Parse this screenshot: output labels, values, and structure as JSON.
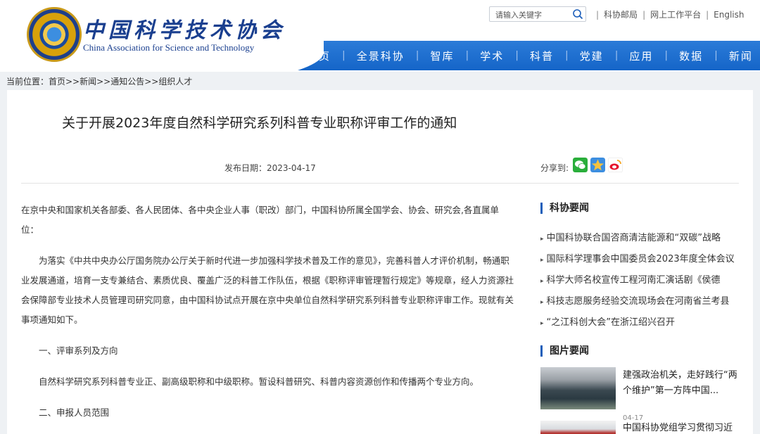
{
  "header": {
    "logo_cn": "中国科学技术协会",
    "logo_en": "China Association for Science and Technology",
    "search_placeholder": "请输入关键字",
    "top_links": [
      "科协邮局",
      "网上工作平台",
      "English"
    ],
    "nav": [
      "首页",
      "全景科协",
      "智库",
      "学术",
      "科普",
      "党建",
      "应用",
      "数据",
      "新闻"
    ]
  },
  "breadcrumb": "当前位置：首页>>新闻>>通知公告>>组织人才",
  "article": {
    "title": "关于开展2023年度自然科学研究系列科普专业职称评审工作的通知",
    "pub_date": "发布日期：2023-04-17",
    "share_label": "分享到:",
    "paragraphs": [
      "在京中央和国家机关各部委、各人民团体、各中央企业人事（职改）部门，中国科协所属全国学会、协会、研究会,各直属单位：",
      "为落实《中共中央办公厅国务院办公厅关于新时代进一步加强科学技术普及工作的意见》，完善科普人才评价机制，畅通职业发展通道，培育一支专兼结合、素质优良、覆盖广泛的科普工作队伍，根据《职称评审管理暂行规定》等规章，经人力资源社会保障部专业技术人员管理司研究同意，由中国科协试点开展在京中央单位自然科学研究系列科普专业职称评审工作。现就有关事项通知如下。",
      "一、评审系列及方向",
      "自然科学研究系列科普专业正、副高级职称和中级职称。暂设科普研究、科普内容资源创作和传播两个专业方向。",
      "二、申报人员范围"
    ]
  },
  "sidebar": {
    "news_heading": "科协要闻",
    "news": [
      "中国科协联合国咨商清洁能源和“双碳”战略",
      "国际科学理事会中国委员会2023年度全体会议",
      "科学大师名校宣传工程河南汇演话剧《侯德",
      "科技志愿服务经验交流现场会在河南省兰考县",
      "“之江科创大会”在浙江绍兴召开"
    ],
    "pics_heading": "图片要闻",
    "pics": [
      {
        "title": "建强政治机关，走好践行“两个维护”第一方阵中国...",
        "date": "04-17"
      },
      {
        "title": "中国科协党组学习贯彻习近",
        "date": ""
      }
    ]
  },
  "colors": {
    "nav_blue": "#1d6fd0",
    "logo_blue": "#1a3f8f",
    "accent": "#1d5fba"
  }
}
